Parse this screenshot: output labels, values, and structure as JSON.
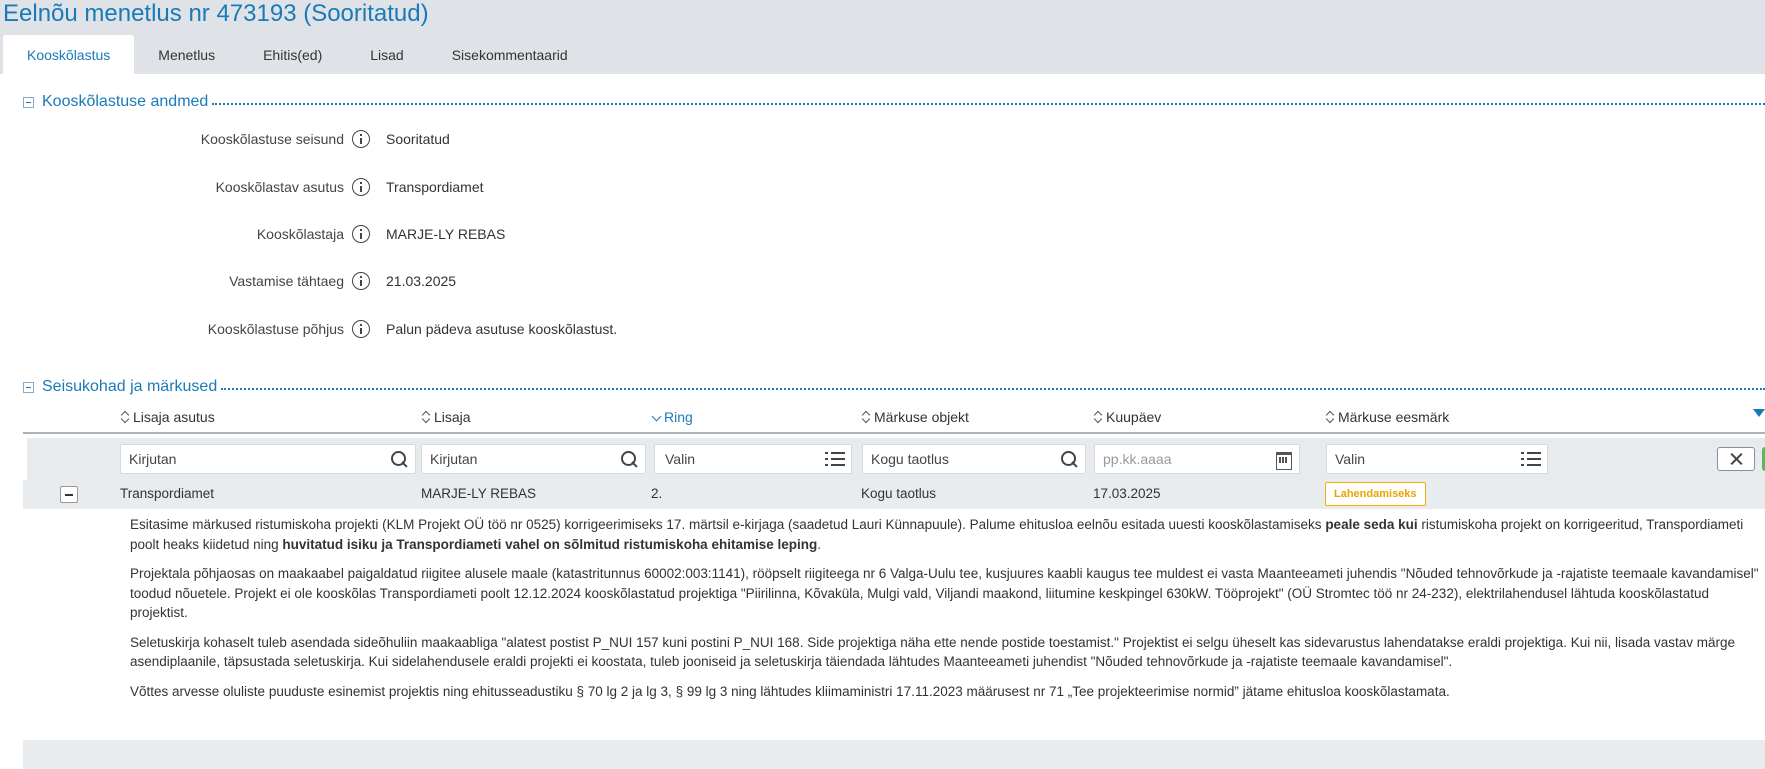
{
  "page": {
    "title": "Eelnõu menetlus nr 473193 (Sooritatud)"
  },
  "tabs": [
    {
      "label": "Kooskõlastus",
      "active": true
    },
    {
      "label": "Menetlus"
    },
    {
      "label": "Ehitis(ed)"
    },
    {
      "label": "Lisad"
    },
    {
      "label": "Sisekommentaarid"
    }
  ],
  "details_section": {
    "title": "Kooskõlastuse andmed",
    "fields": [
      {
        "label": "Kooskõlastuse seisund",
        "value": "Sooritatud"
      },
      {
        "label": "Kooskõlastav asutus",
        "value": "Transpordiamet"
      },
      {
        "label": "Kooskõlastaja",
        "value": "MARJE-LY REBAS"
      },
      {
        "label": "Vastamise tähtaeg",
        "value": "21.03.2025"
      },
      {
        "label": "Kooskõlastuse põhjus",
        "value": "Palun pädeva asutuse kooskõlastust."
      }
    ]
  },
  "remarks_section": {
    "title": "Seisukohad ja märkused",
    "columns": [
      "Lisaja asutus",
      "Lisaja",
      "Ring",
      "Märkuse objekt",
      "Kuupäev",
      "Märkuse eesmärk"
    ],
    "filters": {
      "asutus": "Kirjutan",
      "lisaja": "Kirjutan",
      "ring": "Valin",
      "objekt": "Kogu taotlus",
      "kuupaev": "pp.kk.aaaa",
      "eesmark": "Valin"
    },
    "rows": [
      {
        "asutus": "Transpordiamet",
        "lisaja": "MARJE-LY REBAS",
        "ring": "2.",
        "objekt": "Kogu taotlus",
        "kuupaev": "17.03.2025",
        "eesmark": "Lahendamiseks"
      }
    ],
    "comment": {
      "p1_a": "Esitasime märkused ristumiskoha projekti (KLM Projekt OÜ töö nr 0525) korrigeerimiseks 17. märtsil e-kirjaga (saadetud Lauri Künnapuule). Palume ehitusloa eelnõu esitada uuesti kooskõlastamiseks ",
      "p1_b": "peale seda kui",
      "p1_c": " ristumiskoha projekt on korrigeeritud, Transpordiameti poolt heaks kiidetud ning ",
      "p1_d": "huvitatud isiku ja Transpordiameti vahel on sõlmitud ristumiskoha ehitamise leping",
      "p1_e": ".",
      "p2": "Projektala põhjaosas on maakaabel paigaldatud riigitee alusele maale (katastritunnus 60002:003:1141), rööpselt riigiteega nr 6 Valga-Uulu tee, kusjuures kaabli kaugus tee muldest ei vasta Maanteeameti juhendis \"Nõuded tehnovõrkude ja -rajatiste teemaale kavandamisel\" toodud nõuetele. Projekt ei ole kooskõlas Transpordiameti poolt 12.12.2024 kooskõlastatud projektiga \"Piirilinna, Kõvaküla, Mulgi vald, Viljandi maakond, liitumine keskpingel 630kW. Tööprojekt\" (OÜ Stromtec töö nr 24-232), elektrilahendusel lähtuda kooskõlastatud projektist.",
      "p3": "Seletuskirja kohaselt tuleb asendada sideõhuliin maakaabliga \"alatest postist P_NUI 157 kuni postini P_NUI 168. Side projektiga näha ette nende postide toestamist.\" Projektist ei selgu üheselt kas sidevarustus lahendatakse eraldi projektiga. Kui nii, lisada vastav märge asendiplaanile, täpsustada seletuskirja. Kui sidelahendusele eraldi projekti ei koostata, tuleb jooniseid ja seletuskirja täiendada lähtudes Maanteeameti juhendist \"Nõuded tehnovõrkude ja -rajatiste teemaale kavandamisel\".",
      "p4": "Võttes arvesse oluliste puuduste esinemist projektis ning ehitusseadustiku § 70 lg 2 ja lg 3, § 99 lg 3 ning lähtudes kliimaministri 17.11.2023 määrusest nr 71 „Tee projekteerimise normid” jätame ehitusloa kooskõlastamata."
    }
  },
  "colors": {
    "accent": "#1a7ab8",
    "badge": "#f2b300",
    "apply": "#5cb85c"
  }
}
